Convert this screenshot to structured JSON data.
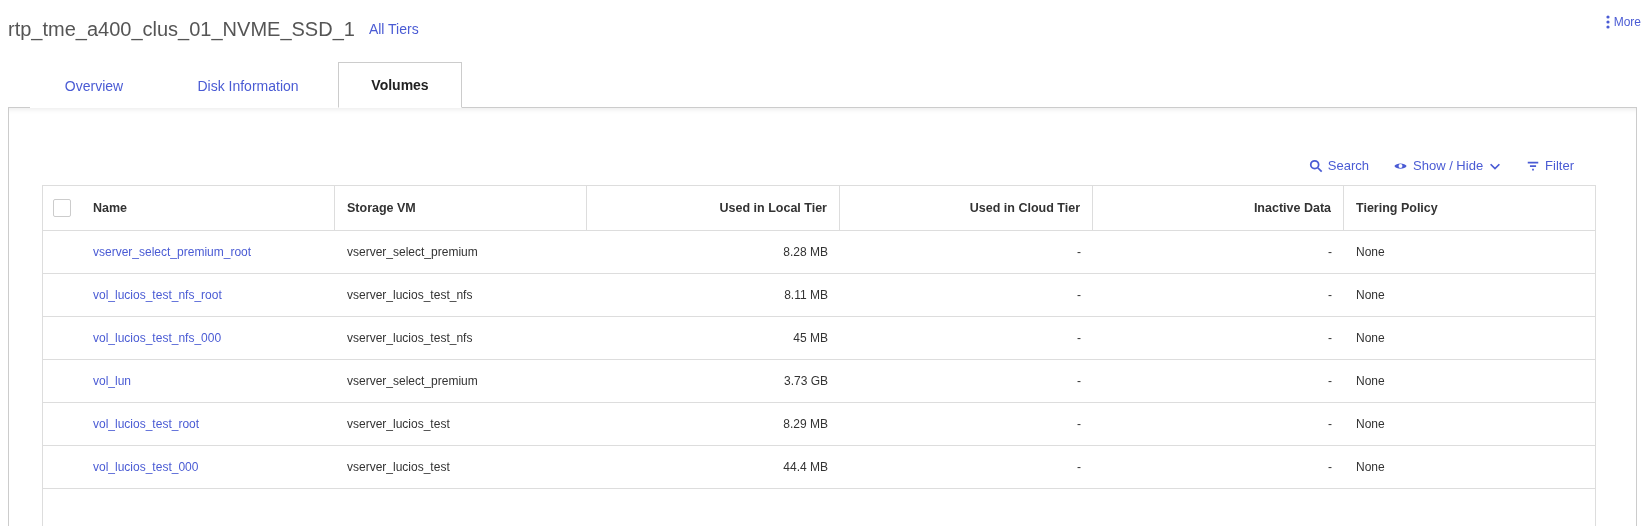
{
  "header": {
    "title": "rtp_tme_a400_clus_01_NVME_SSD_1",
    "link": "All Tiers",
    "more": "More"
  },
  "tabs": [
    {
      "label": "Overview",
      "selected": false
    },
    {
      "label": "Disk Information",
      "selected": false
    },
    {
      "label": "Volumes",
      "selected": true
    }
  ],
  "toolbar": {
    "search": "Search",
    "show_hide": "Show / Hide",
    "filter": "Filter"
  },
  "table": {
    "select_all": {
      "checked": false
    },
    "columns": [
      "Name",
      "Storage VM",
      "Used in Local Tier",
      "Used in Cloud Tier",
      "Inactive Data",
      "Tiering Policy"
    ],
    "rows": [
      [
        "vserver_select_premium_root",
        "vserver_select_premium",
        "8.28 MB",
        "-",
        "-",
        "None"
      ],
      [
        "vol_lucios_test_nfs_root",
        "vserver_lucios_test_nfs",
        "8.11 MB",
        "-",
        "-",
        "None"
      ],
      [
        "vol_lucios_test_nfs_000",
        "vserver_lucios_test_nfs",
        "45 MB",
        "-",
        "-",
        "None"
      ],
      [
        "vol_lun",
        "vserver_select_premium",
        "3.73 GB",
        "-",
        "-",
        "None"
      ],
      [
        "vol_lucios_test_root",
        "vserver_lucios_test",
        "8.29 MB",
        "-",
        "-",
        "None"
      ],
      [
        "vol_lucios_test_000",
        "vserver_lucios_test",
        "44.4 MB",
        "-",
        "-",
        "None"
      ]
    ]
  }
}
